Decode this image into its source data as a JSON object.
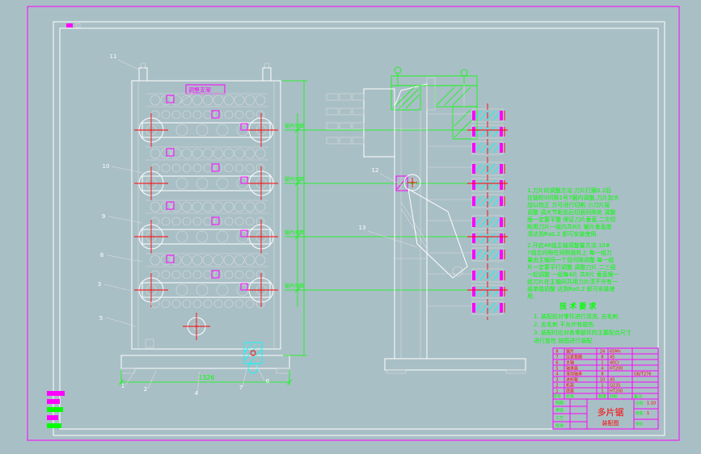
{
  "front_view": {
    "top_label": "调整支架",
    "spacing_labels": [
      "锯片间距",
      "锯片间距",
      "锯片间距",
      "锯片间距"
    ],
    "base_dim": "1326"
  },
  "callouts": [
    "1",
    "2",
    "3",
    "4",
    "5",
    "6",
    "7",
    "8",
    "9",
    "10",
    "11",
    "12",
    "13"
  ],
  "notes": {
    "para1": [
      "1.刀片的调整方法:刀片打磨0.2后",
      "在链轮0间隙1号7圈内调整,刀片加大",
      "加以校正 方可进行切削 小刀片层",
      "调整 调大节距前后切面间隙处 调整",
      "面一定要平整 保证刀片垂直,二次切",
      "削用刀片一组内共8片 锯片垂直度",
      "须达到Ra0.2 即可安装使用."
    ],
    "para2": [
      "2.开启48组主轴调整量方法:10#",
      "7组合间隙在同侧链轮上 每一组刀",
      "量由主轴间一个目间隙调整 每一组",
      "片一定要平行调整 调整刀片 二三组",
      "一起调整 一组每4片 共8片 垂直锯一",
      "组刀片在主轴间共用刀片须不许有一",
      "组单独调整 达到Ra0.2 即可安装使",
      "用."
    ],
    "tech_title": "技 术 要 求",
    "tech_items": [
      "1. 装配前对零件进行清洗, 去毛刺.",
      "2. 去毛刺 不允许有碰伤.",
      "3. 装配时应对各零部件的主要配合尺寸",
      "   进行复检 按图进行装配."
    ]
  },
  "title_block": {
    "parts": [
      {
        "no": "8",
        "name": "锯片",
        "qty": "24",
        "mat": "65Mn",
        "note": ""
      },
      {
        "no": "7",
        "name": "压紧垫圈",
        "qty": "8",
        "mat": "45",
        "note": ""
      },
      {
        "no": "6",
        "name": "主轴",
        "qty": "1",
        "mat": "40Cr",
        "note": ""
      },
      {
        "no": "5",
        "name": "轴承座",
        "qty": "4",
        "mat": "HT200",
        "note": ""
      },
      {
        "no": "4",
        "name": "滚动轴承",
        "qty": "8",
        "mat": "",
        "note": "GB/T276"
      },
      {
        "no": "3",
        "name": "进料辊",
        "qty": "10",
        "mat": "45",
        "note": ""
      },
      {
        "no": "2",
        "name": "机架",
        "qty": "1",
        "mat": "Q235",
        "note": ""
      },
      {
        "no": "1",
        "name": "底座",
        "qty": "1",
        "mat": "HT200",
        "note": ""
      }
    ],
    "headers": {
      "no": "序号",
      "name": "名称",
      "qty": "数量",
      "mat": "材料",
      "note": "备注"
    },
    "title": "多片锯",
    "subtitle": "装配图",
    "left_labels": [
      "制图",
      "审核",
      "工艺",
      "批准"
    ],
    "right_labels": [
      "比例",
      "数量",
      "图号"
    ],
    "right_values": [
      "1:10",
      "1",
      ""
    ]
  }
}
